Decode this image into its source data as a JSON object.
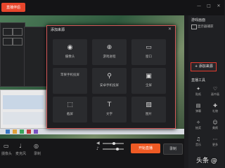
{
  "app": {
    "logo_text": "直播伴侣"
  },
  "window_controls": [
    "—",
    "□",
    "✕"
  ],
  "modal": {
    "title": "添加来源",
    "close": "✕",
    "tiles": [
      {
        "label": "摄像头",
        "icon": "camera-icon",
        "glyph": "◉"
      },
      {
        "label": "游戏进程",
        "icon": "gamepad-icon",
        "glyph": "⊕"
      },
      {
        "label": "窗口",
        "icon": "window-icon",
        "glyph": "▭"
      },
      {
        "label": "苹果手机投屏",
        "icon": "apple-icon",
        "glyph": ""
      },
      {
        "label": "安卓手机投屏",
        "icon": "android-icon",
        "glyph": "⚲"
      },
      {
        "label": "全屏",
        "icon": "monitor-icon",
        "glyph": "▣"
      },
      {
        "label": "截屏",
        "icon": "crop-icon",
        "glyph": "⬚"
      },
      {
        "label": "文字",
        "icon": "text-icon",
        "glyph": "T"
      },
      {
        "label": "图片",
        "icon": "image-icon",
        "glyph": "▨"
      }
    ]
  },
  "sidebar": {
    "scene_header": "游戏画面",
    "scene_item": "显示器捕获",
    "add_source": "+ 添加来源",
    "tools_header": "直播工具",
    "tools": [
      {
        "label": "贴纸",
        "glyph": "✦"
      },
      {
        "label": "画中画",
        "glyph": "♡"
      },
      {
        "label": "弹幕",
        "glyph": "▤"
      },
      {
        "label": "礼物",
        "glyph": "✚"
      },
      {
        "label": "抽奖",
        "glyph": "✧"
      },
      {
        "label": "美颜",
        "glyph": "☺"
      },
      {
        "label": "音乐",
        "glyph": "♫"
      },
      {
        "label": "更多",
        "glyph": "⋯"
      }
    ]
  },
  "controls": {
    "camera_label": "摄像头",
    "mic_label": "麦克风",
    "record_label": "录制",
    "start_button": "开始直播",
    "secondary_button": "录制"
  },
  "watermark": "头条 @"
}
